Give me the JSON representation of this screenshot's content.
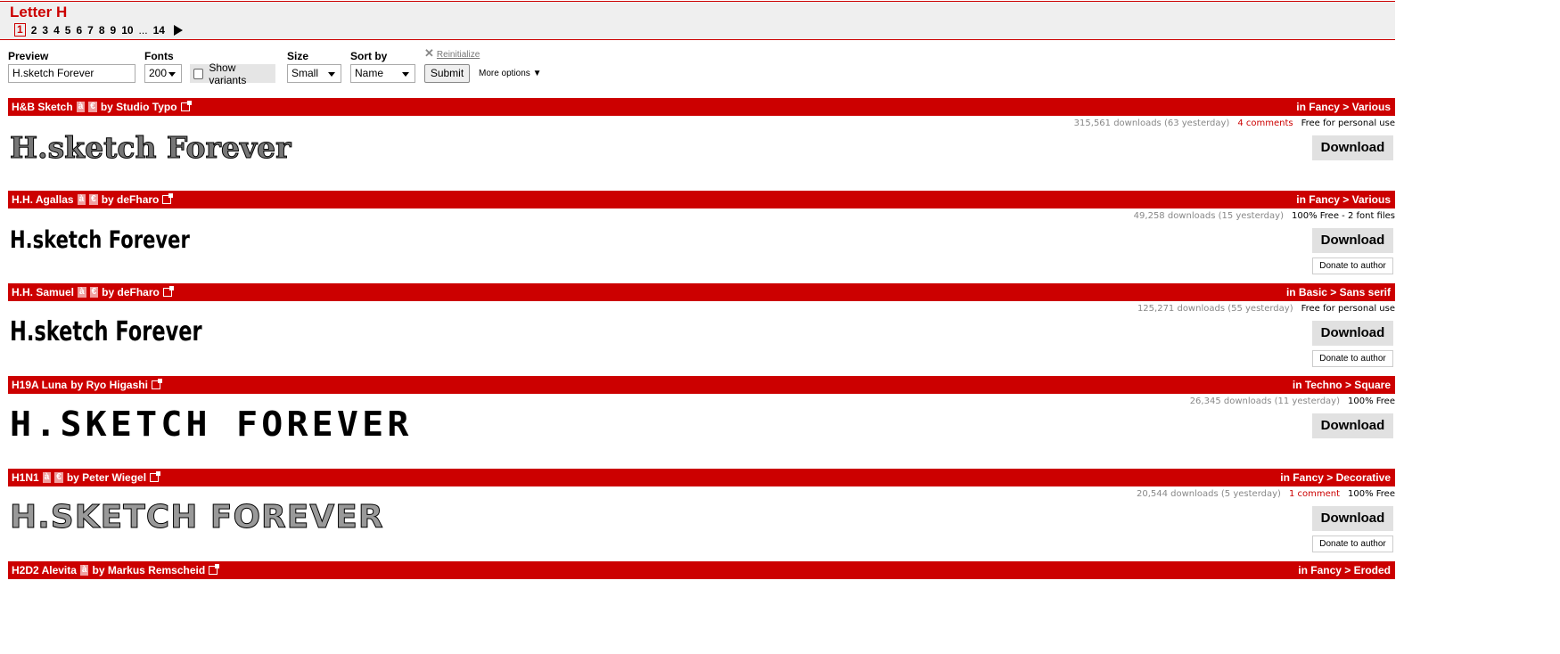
{
  "header": {
    "title": "Letter H",
    "pages": [
      "1",
      "2",
      "3",
      "4",
      "5",
      "6",
      "7",
      "8",
      "9",
      "10",
      "...",
      "14"
    ],
    "current_page": "1"
  },
  "form": {
    "preview_label": "Preview",
    "preview_value": "H.sketch Forever",
    "fonts_label": "Fonts",
    "fonts_value": "200",
    "show_variants": "Show variants",
    "show_variants_checked": false,
    "size_label": "Size",
    "size_value": "Small",
    "sort_label": "Sort by",
    "sort_value": "Name",
    "reinitialize": "Reinitialize",
    "submit": "Submit",
    "more_options": "More options"
  },
  "download_label": "Download",
  "donate_label": "Donate to author",
  "accent": "#cc0000",
  "fonts": [
    {
      "name": "H&B Sketch",
      "badges": [
        "à",
        "€"
      ],
      "by": "by Studio Typo",
      "category": "in Fancy > Various",
      "downloads": "315,561 downloads (63 yesterday)",
      "comments": "4 comments",
      "license": "Free for personal use",
      "preview": "H.sketch Forever",
      "donate": false
    },
    {
      "name": "H.H. Agallas",
      "badges": [
        "à",
        "€"
      ],
      "by": "by deFharo",
      "category": "in Fancy > Various",
      "downloads": "49,258 downloads (15 yesterday)",
      "comments": "",
      "license": "100% Free - 2 font files",
      "preview": "H.sketch Forever",
      "donate": true
    },
    {
      "name": "H.H. Samuel",
      "badges": [
        "à",
        "€"
      ],
      "by": "by deFharo",
      "category": "in Basic > Sans serif",
      "downloads": "125,271 downloads (55 yesterday)",
      "comments": "",
      "license": "Free for personal use",
      "preview": "H.sketch Forever",
      "donate": true
    },
    {
      "name": "H19A Luna",
      "badges": [],
      "by": "by Ryo Higashi",
      "category": "in Techno > Square",
      "downloads": "26,345 downloads (11 yesterday)",
      "comments": "",
      "license": "100% Free",
      "preview": "H.SKETCH FOREVER",
      "donate": false
    },
    {
      "name": "H1N1",
      "badges": [
        "à",
        "€"
      ],
      "by": "by Peter Wiegel",
      "category": "in Fancy > Decorative",
      "downloads": "20,544 downloads (5 yesterday)",
      "comments": "1 comment",
      "license": "100% Free",
      "preview": "H.SKETCH FOREVER",
      "donate": true
    },
    {
      "name": "H2D2 Alevita",
      "badges": [
        "à"
      ],
      "by": "by Markus Remscheid",
      "category": "in Fancy > Eroded",
      "downloads": "",
      "comments": "",
      "license": "",
      "preview": "",
      "donate": false
    }
  ]
}
